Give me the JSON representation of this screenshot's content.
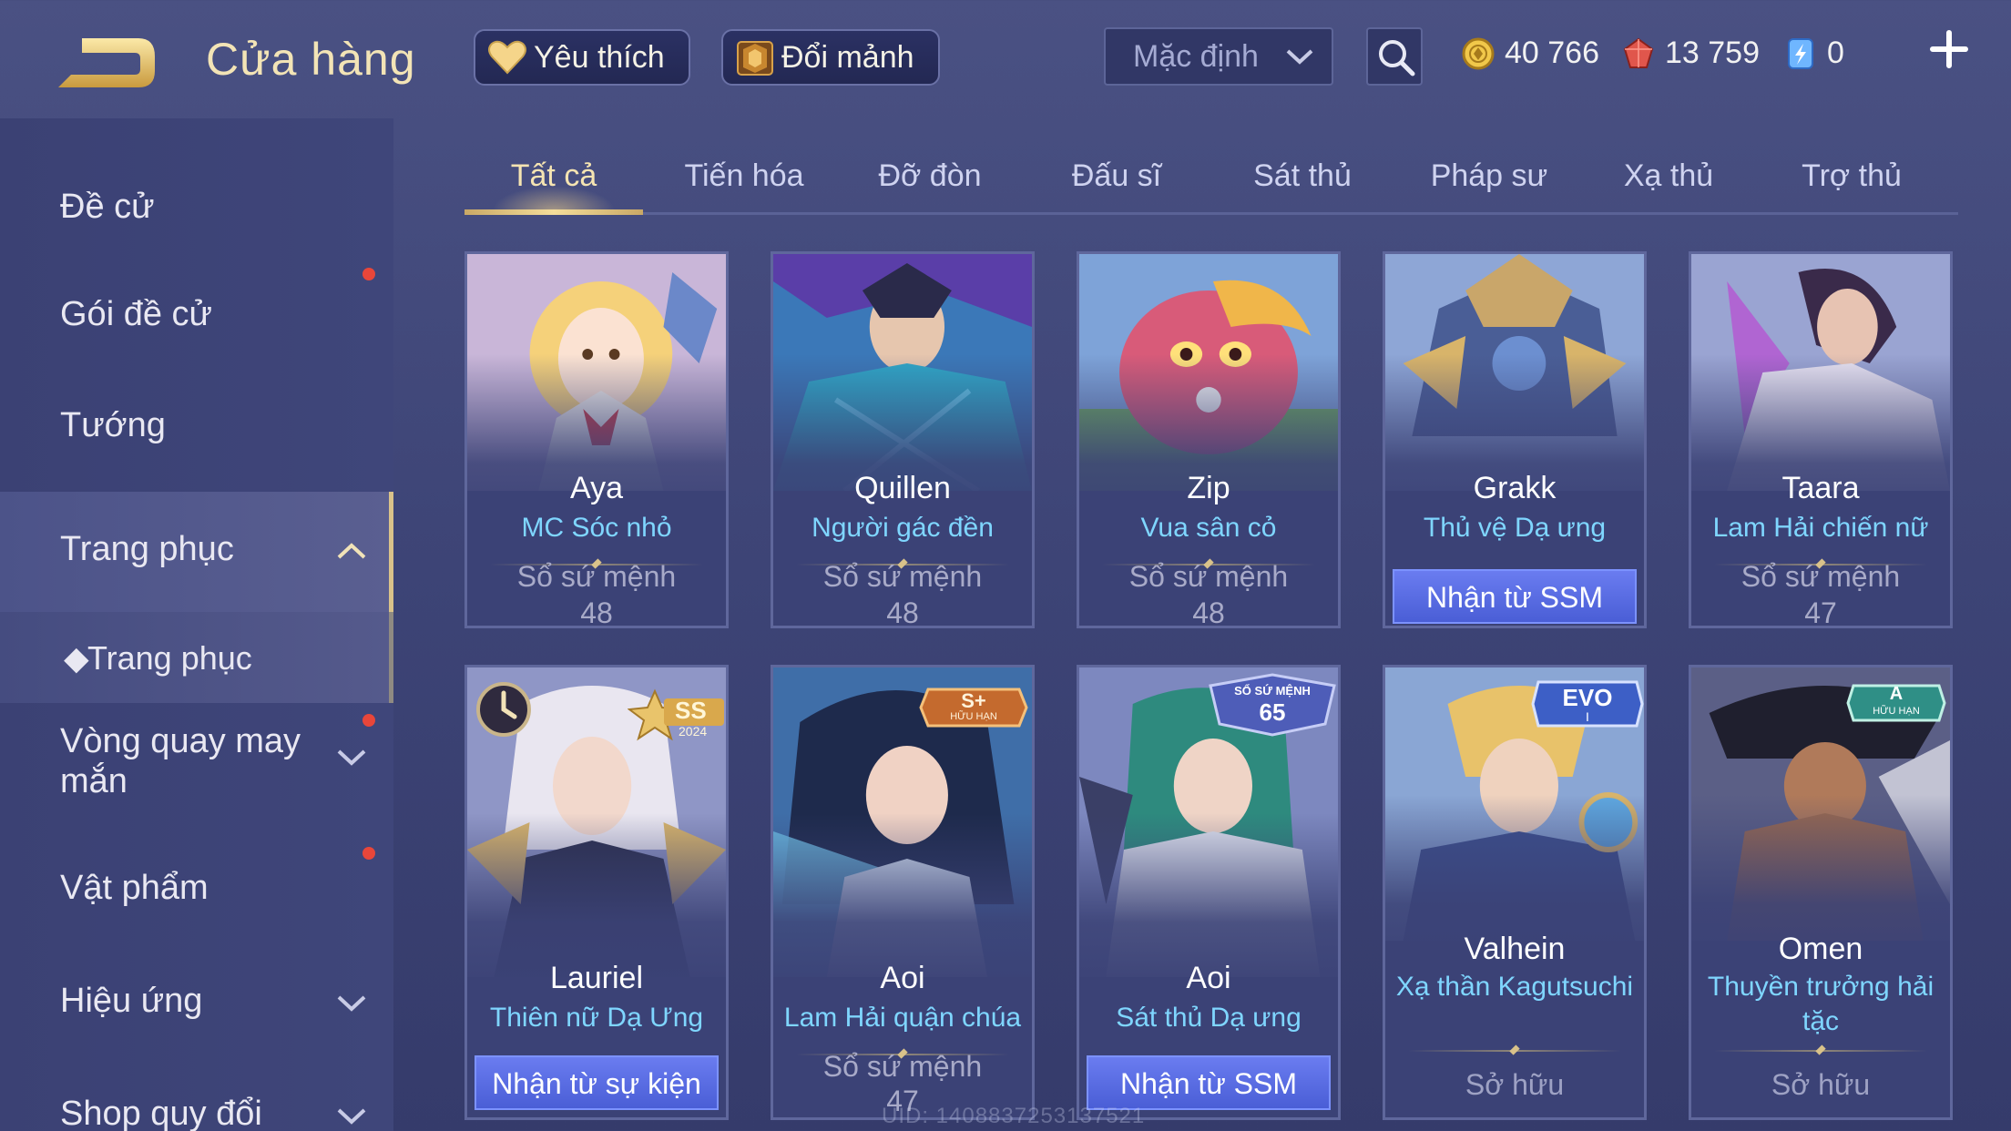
{
  "header": {
    "title": "Cửa hàng",
    "favorite_label": "Yêu thích",
    "exchange_label": "Đổi mảnh",
    "sort_value": "Mặc định"
  },
  "currency": {
    "gold": "40 766",
    "voucher": "13 759",
    "crystal": "0"
  },
  "sidebar": {
    "items": [
      {
        "label": "Đề cử",
        "dot": false
      },
      {
        "label": "Gói đề cử",
        "dot": true
      },
      {
        "label": "Tướng",
        "dot": false
      },
      {
        "label": "Trang phục",
        "dot": false,
        "expanded": true
      },
      {
        "label": "Trang phục",
        "sub": true
      },
      {
        "label": "Vòng quay may mắn",
        "dot": true
      },
      {
        "label": "Vật phẩm",
        "dot": true
      },
      {
        "label": "Hiệu ứng",
        "dot": false
      },
      {
        "label": "Shop quy đổi",
        "dot": false
      }
    ]
  },
  "tabs": [
    "Tất cả",
    "Tiến hóa",
    "Đỡ đòn",
    "Đấu sĩ",
    "Sát thủ",
    "Pháp sư",
    "Xạ thủ",
    "Trợ thủ"
  ],
  "cards": [
    {
      "hero": "Aya",
      "skin": "MC Sóc nhỏ",
      "price_label": "Sổ sứ mệnh",
      "price_value": "48"
    },
    {
      "hero": "Quillen",
      "skin": "Người gác đền",
      "price_label": "Sổ sứ mệnh",
      "price_value": "48"
    },
    {
      "hero": "Zip",
      "skin": "Vua sân cỏ",
      "price_label": "Sổ sứ mệnh",
      "price_value": "48"
    },
    {
      "hero": "Grakk",
      "skin": "Thủ vệ Dạ ưng",
      "button": "Nhận từ SSM"
    },
    {
      "hero": "Taara",
      "skin": "Lam Hải chiến nữ",
      "price_label": "Sổ sứ mệnh",
      "price_value": "47"
    },
    {
      "hero": "Lauriel",
      "skin": "Thiên nữ Dạ Ưng",
      "button": "Nhận từ sự kiện",
      "badge": "SS",
      "badge_sub": "2024"
    },
    {
      "hero": "Aoi",
      "skin": "Lam Hải quận chúa",
      "price_label": "Sổ sứ mệnh",
      "price_value": "47",
      "badge": "S+",
      "badge_sub": "HỮU HẠN"
    },
    {
      "hero": "Aoi",
      "skin": "Sát thủ Dạ ưng",
      "button": "Nhận từ SSM",
      "badge": "SỔ SỨ MỆNH",
      "badge_sub": "65"
    },
    {
      "hero": "Valhein",
      "skin": "Xạ thần Kagutsuchi",
      "owned": "Sở hữu",
      "badge": "EVO",
      "badge_sub": "I"
    },
    {
      "hero": "Omen",
      "skin": "Thuyền trưởng hải tặc",
      "owned": "Sở hữu",
      "badge": "A",
      "badge_sub": "HỮU HẠN"
    }
  ],
  "uid_text": "UID: 1408837253137521",
  "colors": {
    "accent_gold": "#f3e4b6",
    "skin_name": "#7fd6ff",
    "button_blue": "#5a6de0",
    "notify_dot": "#e8463a"
  }
}
